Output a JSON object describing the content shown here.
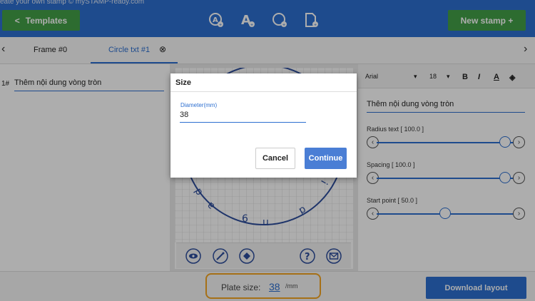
{
  "header": {
    "tagline": "eate your own stamp © mySTAMP-ready.com",
    "templates_label": "Templates",
    "new_stamp_label": "New stamp +"
  },
  "tabs": [
    {
      "label": "Frame #0"
    },
    {
      "label": "Circle txt #1"
    }
  ],
  "left_panel": {
    "row_number": "1#",
    "row_text": "Thêm nội dung vòng tròn"
  },
  "right_panel": {
    "font_family": "Arial",
    "font_size": "18",
    "text_value": "Thêm nội dung vòng tròn",
    "sliders": [
      {
        "label": "Radius text [ 100.0 ]",
        "value": 1.0
      },
      {
        "label": "Spacing [ 100.0 ]",
        "value": 1.0
      },
      {
        "label": "Start point [ 50.0 ]",
        "value": 0.5
      }
    ]
  },
  "preview": {
    "circle_letters": [
      "p",
      "ɐ",
      "6",
      "u",
      "p",
      "!"
    ]
  },
  "bottom": {
    "plate_label": "Plate size:",
    "plate_value": "38",
    "plate_unit": "/mm",
    "download_label": "Download layout"
  },
  "dialog": {
    "title": "Size",
    "field_label": "Diameter(mm)",
    "field_value": "38",
    "cancel_label": "Cancel",
    "continue_label": "Continue"
  },
  "colors": {
    "primary": "#2d6fd0",
    "green": "#43a047",
    "highlight": "#f5a623"
  }
}
